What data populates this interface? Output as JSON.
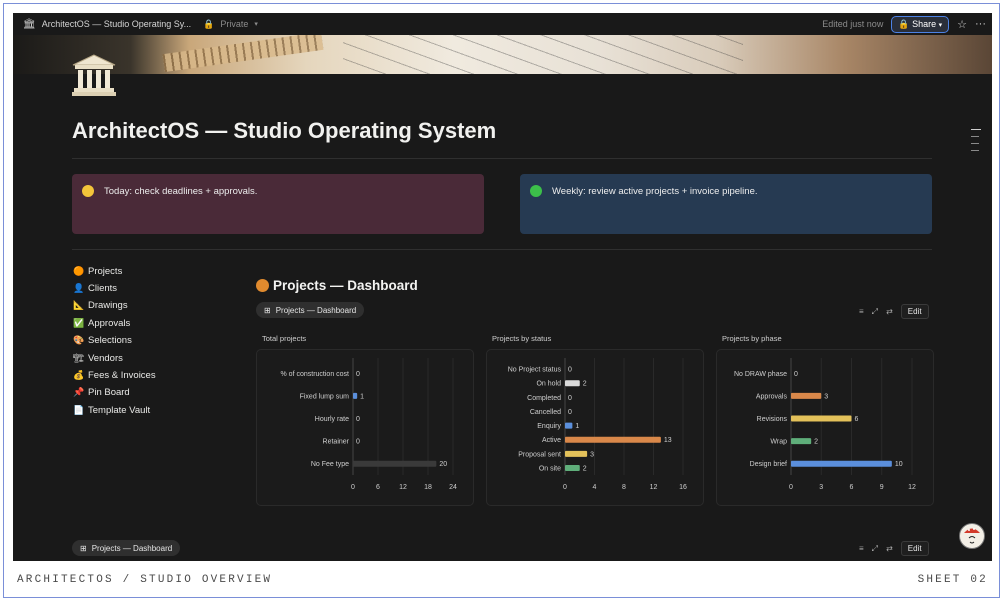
{
  "window": {
    "page_title": "ArchitectOS — Studio Operating Sy...",
    "privacy": "Private",
    "edited": "Edited just now",
    "share_label": "Share"
  },
  "page": {
    "title": "ArchitectOS — Studio Operating System",
    "callouts": [
      {
        "text": "Today: check deadlines + approvals.",
        "bg": "#4a2a38",
        "dot": "#f3c53a"
      },
      {
        "text": "Weekly: review active projects + invoice pipeline.",
        "bg": "#263a52",
        "dot": "#3cbf4a"
      }
    ]
  },
  "nav": {
    "items": [
      {
        "icon": "🟠",
        "label": "Projects"
      },
      {
        "icon": "👤",
        "label": "Clients"
      },
      {
        "icon": "📐",
        "label": "Drawings"
      },
      {
        "icon": "✅",
        "label": "Approvals"
      },
      {
        "icon": "🎨",
        "label": "Selections"
      },
      {
        "icon": "🏗",
        "label": "Vendors"
      },
      {
        "icon": "💰",
        "label": "Fees & Invoices"
      },
      {
        "icon": "📌",
        "label": "Pin Board"
      },
      {
        "icon": "📄",
        "label": "Template Vault"
      }
    ]
  },
  "dashboard": {
    "heading": "Projects — Dashboard",
    "view_chip": "Projects — Dashboard",
    "edit_label": "Edit",
    "bottom_chip": "Projects — Dashboard",
    "bottom_edit_label": "Edit"
  },
  "chart_data": [
    {
      "type": "bar",
      "orientation": "horizontal",
      "title": "Total projects",
      "categories": [
        "% of construction cost",
        "Fixed lump sum",
        "Hourly rate",
        "Retainer",
        "No Fee type"
      ],
      "values": [
        0,
        1,
        0,
        0,
        20
      ],
      "colors": [
        "#555555",
        "#5b8fdc",
        "#555555",
        "#555555",
        "#3a3a3a"
      ],
      "xlim": [
        0,
        24
      ],
      "ticks": [
        "0",
        "6",
        "12",
        "18",
        "24"
      ]
    },
    {
      "type": "bar",
      "orientation": "horizontal",
      "title": "Projects by status",
      "categories": [
        "No Project status",
        "On hold",
        "Completed",
        "Cancelled",
        "Enquiry",
        "Active",
        "Proposal sent",
        "On site"
      ],
      "values": [
        0,
        2,
        0,
        0,
        1,
        13,
        3,
        2
      ],
      "colors": [
        "#555555",
        "#d9d9d9",
        "#555555",
        "#555555",
        "#5b8fdc",
        "#d9884a",
        "#e3c15a",
        "#5fae7a"
      ],
      "xlim": [
        0,
        16
      ],
      "ticks": [
        "0",
        "4",
        "8",
        "12",
        "16"
      ]
    },
    {
      "type": "bar",
      "orientation": "horizontal",
      "title": "Projects by phase",
      "categories": [
        "No DRAW phase",
        "Approvals",
        "Revisions",
        "Wrap",
        "Design brief"
      ],
      "values": [
        0,
        3,
        6,
        2,
        10
      ],
      "colors": [
        "#555555",
        "#d9884a",
        "#e3c15a",
        "#5fae7a",
        "#5b8fdc"
      ],
      "xlim": [
        0,
        12
      ],
      "ticks": [
        "0",
        "3",
        "6",
        "9",
        "12"
      ]
    }
  ],
  "footer": {
    "left_caption": "ARCHITECTOS / STUDIO OVERVIEW",
    "right_caption": "SHEET 02"
  }
}
